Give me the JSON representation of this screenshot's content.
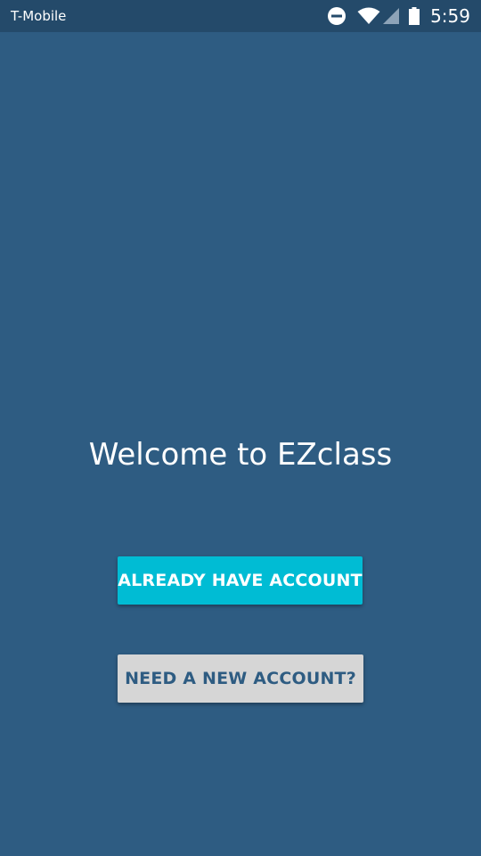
{
  "status_bar": {
    "carrier": "T-Mobile",
    "time": "5:59",
    "icons": [
      "do-not-disturb-icon",
      "wifi-icon",
      "cell-signal-icon",
      "battery-icon"
    ]
  },
  "welcome": {
    "title": "Welcome to EZclass"
  },
  "buttons": {
    "login_label": "ALREADY HAVE ACCOUNT",
    "signup_label": "NEED A NEW ACCOUNT?"
  },
  "colors": {
    "background": "#2e5c82",
    "status_bar": "#244a6a",
    "primary_button": "#00bcd4",
    "secondary_button": "#d6d6d6"
  }
}
